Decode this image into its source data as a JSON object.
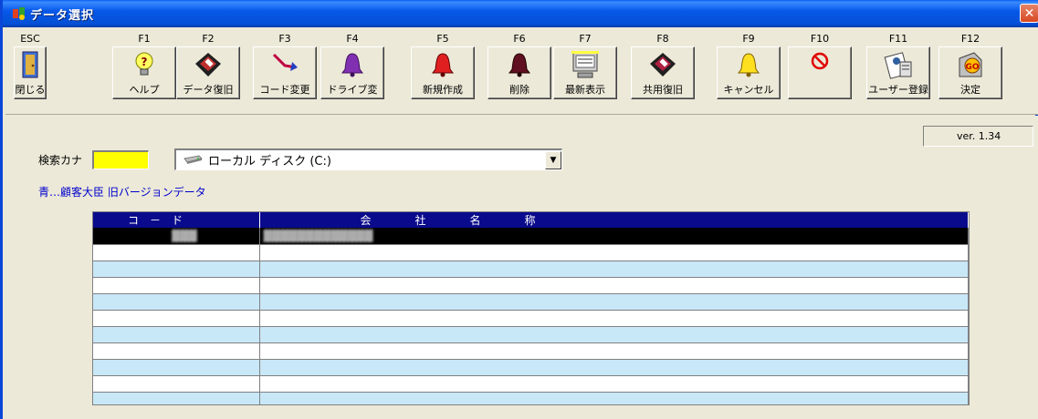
{
  "window": {
    "title": "データ選択",
    "close_label": "✕"
  },
  "toolbar": [
    {
      "key": "ESC",
      "label": "閉じる",
      "icon": "door-icon"
    },
    {
      "key": "F1",
      "label": "ヘルプ",
      "icon": "help-bulb-icon"
    },
    {
      "key": "F2",
      "label": "データ復旧",
      "icon": "floppy-restore-icon"
    },
    {
      "key": "F3",
      "label": "コード変更",
      "icon": "arrow-change-icon"
    },
    {
      "key": "F4",
      "label": "ドライブ変",
      "icon": "purple-bell-icon"
    },
    {
      "key": "F5",
      "label": "新規作成",
      "icon": "red-bell-icon"
    },
    {
      "key": "F6",
      "label": "削除",
      "icon": "dark-bell-icon"
    },
    {
      "key": "F7",
      "label": "最新表示",
      "icon": "refresh-screen-icon"
    },
    {
      "key": "F8",
      "label": "共用復旧",
      "icon": "floppy-shared-icon"
    },
    {
      "key": "F9",
      "label": "キャンセル",
      "icon": "yellow-bell-icon"
    },
    {
      "key": "F10",
      "label": "",
      "icon": "prohibited-icon"
    },
    {
      "key": "F11",
      "label": "ユーザー登録",
      "icon": "user-register-icon"
    },
    {
      "key": "F12",
      "label": "決定",
      "icon": "go-decide-icon"
    }
  ],
  "version": "ver. 1.34",
  "search": {
    "label": "検索カナ",
    "value": ""
  },
  "drive": {
    "selected": "ローカル ディスク (C:)"
  },
  "old_data_link": "青…顧客大臣  旧バージョンデータ",
  "grid": {
    "columns": [
      "コ　－　ド",
      "会　　　　社　　　　名　　　　称"
    ],
    "rows": [
      {
        "code": "▓▓▓",
        "name": "▓▓▓▓▓▓▓▓▓▓▓▓▓",
        "selected": true
      },
      {
        "code": "",
        "name": ""
      },
      {
        "code": "",
        "name": ""
      },
      {
        "code": "",
        "name": ""
      },
      {
        "code": "",
        "name": ""
      },
      {
        "code": "",
        "name": ""
      },
      {
        "code": "",
        "name": ""
      },
      {
        "code": "",
        "name": ""
      },
      {
        "code": "",
        "name": ""
      },
      {
        "code": "",
        "name": ""
      },
      {
        "code": "",
        "name": ""
      }
    ]
  },
  "colors": {
    "title_blue": "#0a5ff0",
    "header_navy": "#0a0a8c",
    "row_alt": "#c8e8f8",
    "search_bg": "#ffff00"
  }
}
